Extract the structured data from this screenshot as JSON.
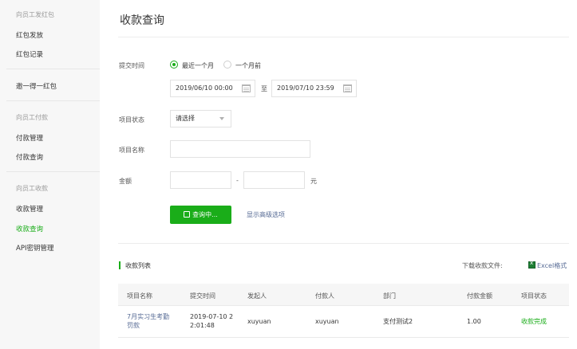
{
  "sidebar": {
    "group1": "向员工发红包",
    "items1": [
      "红包发放",
      "红包记录"
    ],
    "single": "邀一得一红包",
    "group2": "向员工付款",
    "items2": [
      "付款管理",
      "付款查询"
    ],
    "group3": "向员工收款",
    "items3": [
      "收款管理",
      "收款查询",
      "API密钥管理"
    ],
    "active_color": "#1aad19"
  },
  "main": {
    "title": "收款查询",
    "form": {
      "submit_time_label": "提交时间",
      "radio_recent_month": "最近一个月",
      "radio_month_ago": "一个月前",
      "start_time": "2019/06/10 00:00",
      "to_text": "至",
      "end_time": "2019/07/10 23:59",
      "status_label": "项目状态",
      "status_value": "请选择",
      "name_label": "项目名称",
      "name_value": "",
      "amount_label": "金额",
      "amount_min": "",
      "amount_sep": "-",
      "amount_max": "",
      "amount_unit": "元",
      "query_button": "查询中...",
      "advanced_link": "显示高级选项"
    },
    "list": {
      "title": "收款列表",
      "download_label": "下载收款文件:",
      "excel_link": "Excel格式",
      "columns": [
        "项目名称",
        "提交时间",
        "发起人",
        "付款人",
        "部门",
        "付款金额",
        "项目状态"
      ],
      "rows": [
        {
          "name_line1": "7月实习生考勤",
          "name_line2": "罚款",
          "time_line1": "2019-07-10 2",
          "time_line2": "2:01:48",
          "initiator": "xuyuan",
          "payer": "xuyuan",
          "department": "支付测试2",
          "amount": "1.00",
          "status": "收款完成"
        }
      ]
    }
  },
  "colors": {
    "brand_green": "#1aad19",
    "link_blue": "#576b95"
  }
}
